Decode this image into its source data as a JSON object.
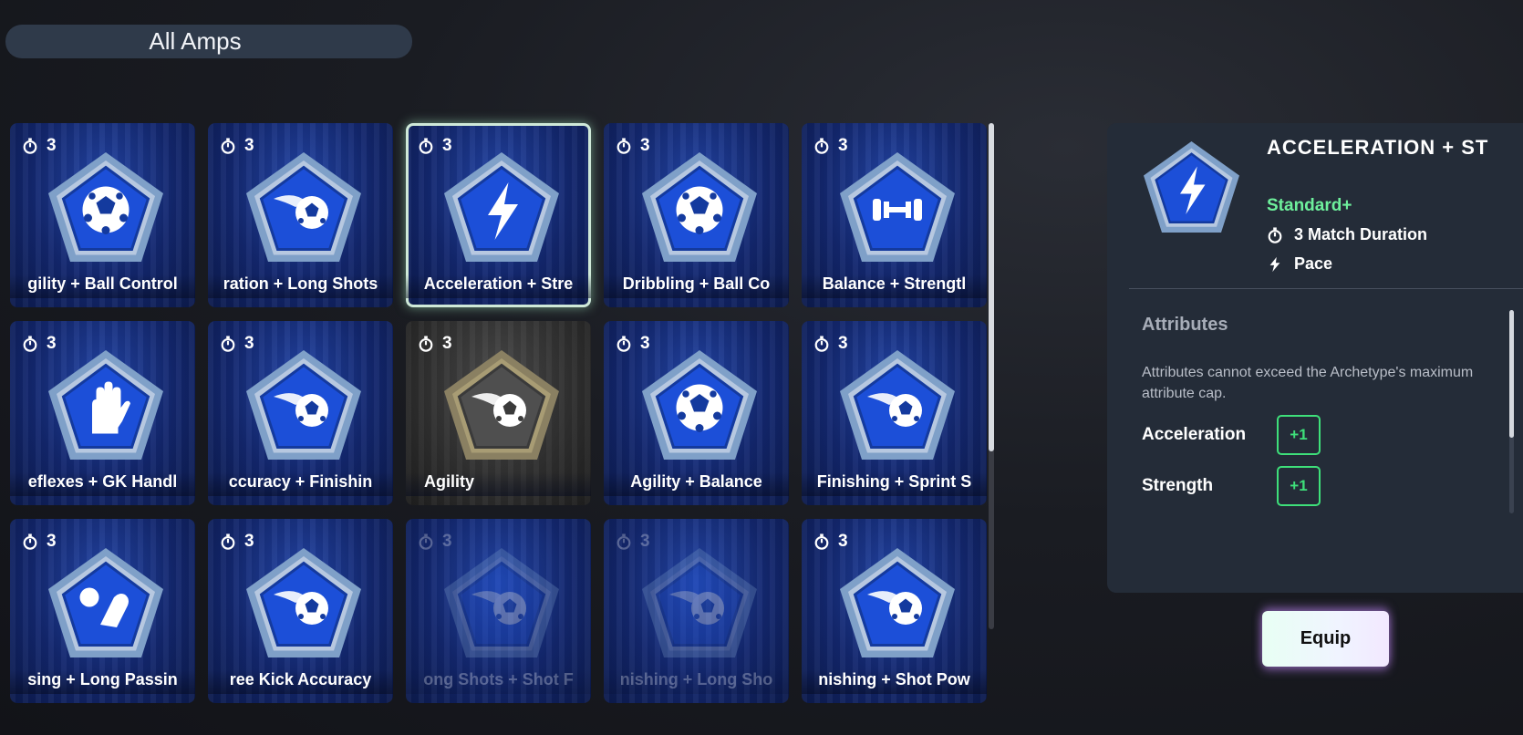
{
  "filter": {
    "label": "All Amps"
  },
  "colors": {
    "accent_green": "#3ee07a",
    "tier_green": "#6ef09c",
    "badge_blue": "#1c4fd8",
    "badge_grey": "#6a6a6a"
  },
  "amps": [
    {
      "label": "gility + Ball Control",
      "duration": "3",
      "icon": "ball-icon",
      "style": "blue"
    },
    {
      "label": "ration + Long Shots",
      "duration": "3",
      "icon": "fast-ball-icon",
      "style": "blue"
    },
    {
      "label": "Acceleration + Stre",
      "duration": "3",
      "icon": "lightning-icon",
      "style": "blue",
      "selected": true
    },
    {
      "label": "Dribbling + Ball Co",
      "duration": "3",
      "icon": "ball-icon",
      "style": "blue"
    },
    {
      "label": "Balance + Strengtl",
      "duration": "3",
      "icon": "dumbbell-icon",
      "style": "blue"
    },
    {
      "label": "eflexes + GK Handl",
      "duration": "3",
      "icon": "glove-icon",
      "style": "blue"
    },
    {
      "label": "ccuracy + Finishin",
      "duration": "3",
      "icon": "fast-ball-icon",
      "style": "blue"
    },
    {
      "label": "Agility",
      "duration": "3",
      "icon": "fast-ball-icon",
      "style": "grey"
    },
    {
      "label": "Agility + Balance",
      "duration": "3",
      "icon": "ball-icon",
      "style": "blue"
    },
    {
      "label": "Finishing + Sprint S",
      "duration": "3",
      "icon": "fast-ball-icon",
      "style": "blue"
    },
    {
      "label": "sing + Long Passin",
      "duration": "3",
      "icon": "boot-ball-icon",
      "style": "blue"
    },
    {
      "label": "ree Kick Accuracy",
      "duration": "3",
      "icon": "fast-ball-icon",
      "style": "blue"
    },
    {
      "label": "ong Shots + Shot F",
      "duration": "3",
      "icon": "fast-ball-icon",
      "style": "blue",
      "faded": true
    },
    {
      "label": "nishing + Long Sho",
      "duration": "3",
      "icon": "fast-ball-icon",
      "style": "blue",
      "faded": true
    },
    {
      "label": "nishing + Shot Pow",
      "duration": "3",
      "icon": "fast-ball-icon",
      "style": "blue"
    }
  ],
  "detail": {
    "title": "ACCELERATION + ST",
    "tier": "Standard+",
    "duration": "3 Match Duration",
    "category": "Pace",
    "attributes_heading": "Attributes",
    "attributes_note": "Attributes cannot exceed the Archetype's maximum attribute cap.",
    "attributes": [
      {
        "name": "Acceleration",
        "value": "+1"
      },
      {
        "name": "Strength",
        "value": "+1"
      }
    ]
  },
  "equip_label": "Equip"
}
